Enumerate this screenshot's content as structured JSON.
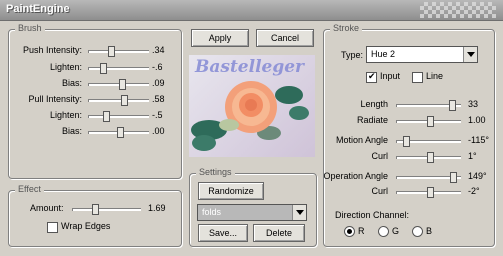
{
  "window": {
    "title": "PaintEngine"
  },
  "brush": {
    "legend": "Brush",
    "sliders": [
      {
        "label": "Push Intensity:",
        "value": ".34",
        "level": 0.34
      },
      {
        "label": "Lighten:",
        "value": "-.6",
        "level": 0.2
      },
      {
        "label": "Bias:",
        "value": ".09",
        "level": 0.55
      },
      {
        "label": "Pull Intensity:",
        "value": ".58",
        "level": 0.58
      },
      {
        "label": "Lighten:",
        "value": "-.5",
        "level": 0.25
      },
      {
        "label": "Bias:",
        "value": ".00",
        "level": 0.5
      }
    ]
  },
  "effect": {
    "legend": "Effect",
    "amount_label": "Amount:",
    "amount_value": "1.69",
    "amount_level": 0.3,
    "wrap_edges_label": "Wrap Edges",
    "wrap_edges_checked": false
  },
  "buttons": {
    "apply": "Apply",
    "cancel": "Cancel"
  },
  "preview": {
    "watermark": "Bastelleger"
  },
  "settings": {
    "legend": "Settings",
    "randomize": "Randomize",
    "preset_value": "folds",
    "save": "Save...",
    "delete": "Delete"
  },
  "stroke": {
    "legend": "Stroke",
    "type_label": "Type:",
    "type_value": "Hue 2",
    "input_label": "Input",
    "input_checked": true,
    "line_label": "Line",
    "line_checked": false,
    "sliders": [
      {
        "label": "Length",
        "value": "33",
        "level": 0.88
      },
      {
        "label": "Radiate",
        "value": "1.00",
        "level": 0.5
      },
      {
        "label": "Motion Angle",
        "value": "-115°",
        "level": 0.1
      },
      {
        "label": "Curl",
        "value": "1°",
        "level": 0.5
      },
      {
        "label": "Operation Angle",
        "value": "149°",
        "level": 0.9
      },
      {
        "label": "Curl",
        "value": "-2°",
        "level": 0.5
      }
    ],
    "direction_channel_label": "Direction Channel:",
    "channels": [
      {
        "label": "R",
        "selected": true
      },
      {
        "label": "G",
        "selected": false
      },
      {
        "label": "B",
        "selected": false
      }
    ]
  }
}
